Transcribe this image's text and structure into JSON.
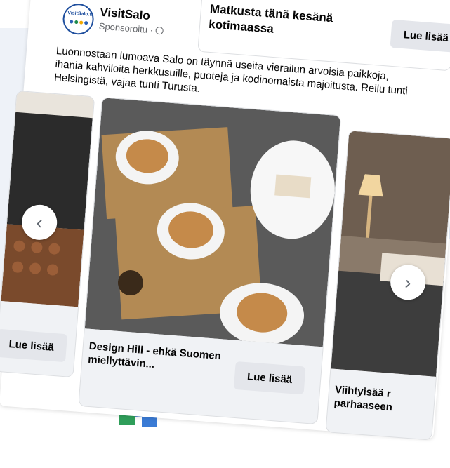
{
  "post": {
    "page_name": "VisitSalo",
    "avatar_brand": "VisitSalo.fi",
    "sponsored": "Sponsoroitu ·",
    "text": "Luonnostaan lumoava Salo on täynnä useita vierailun arvoisia paikkoja, ihania kahviloita herkkusuille, puoteja ja kodinomaista majoitusta. Reilu tunti Helsingistä, vajaa tunti Turusta."
  },
  "top_card": {
    "title": "Matkusta tänä kesänä kotimaassa",
    "button": "Lue lisää"
  },
  "carousel": {
    "slides": [
      {
        "caption": "",
        "button": "Lue lisää"
      },
      {
        "caption": "Design Hill - ehkä Suomen miellyttävin...",
        "button": "Lue lisää"
      },
      {
        "caption": "Viihtyisää r parhaaseen",
        "button": ""
      }
    ],
    "prev_icon": "chevron-left-icon",
    "next_icon": "chevron-right-icon"
  },
  "icons": {
    "globe": "globe-icon",
    "more": "more-options-icon"
  },
  "colors": {
    "brand_blue": "#1f4f9e",
    "button_gray": "#e4e6eb",
    "text_secondary": "#65676b"
  }
}
